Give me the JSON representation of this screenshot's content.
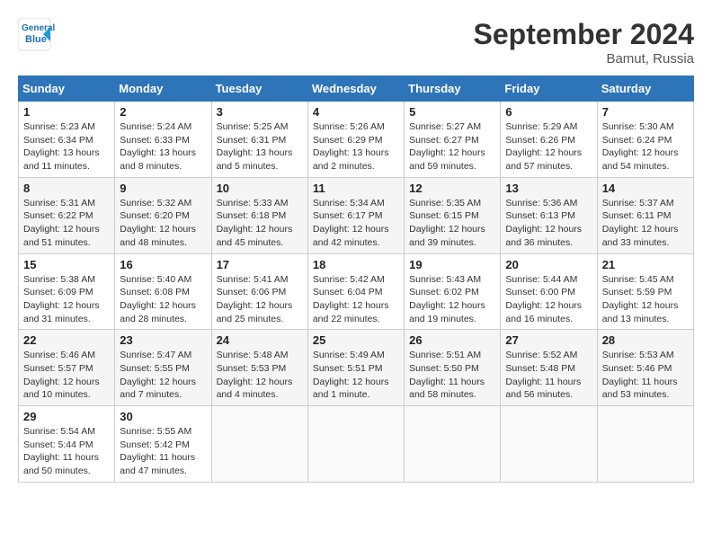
{
  "header": {
    "logo_line1": "General",
    "logo_line2": "Blue",
    "month_title": "September 2024",
    "location": "Bamut, Russia"
  },
  "days_of_week": [
    "Sunday",
    "Monday",
    "Tuesday",
    "Wednesday",
    "Thursday",
    "Friday",
    "Saturday"
  ],
  "weeks": [
    [
      {
        "day": "1",
        "sunrise": "5:23 AM",
        "sunset": "6:34 PM",
        "daylight": "13 hours and 11 minutes."
      },
      {
        "day": "2",
        "sunrise": "5:24 AM",
        "sunset": "6:33 PM",
        "daylight": "13 hours and 8 minutes."
      },
      {
        "day": "3",
        "sunrise": "5:25 AM",
        "sunset": "6:31 PM",
        "daylight": "13 hours and 5 minutes."
      },
      {
        "day": "4",
        "sunrise": "5:26 AM",
        "sunset": "6:29 PM",
        "daylight": "13 hours and 2 minutes."
      },
      {
        "day": "5",
        "sunrise": "5:27 AM",
        "sunset": "6:27 PM",
        "daylight": "12 hours and 59 minutes."
      },
      {
        "day": "6",
        "sunrise": "5:29 AM",
        "sunset": "6:26 PM",
        "daylight": "12 hours and 57 minutes."
      },
      {
        "day": "7",
        "sunrise": "5:30 AM",
        "sunset": "6:24 PM",
        "daylight": "12 hours and 54 minutes."
      }
    ],
    [
      {
        "day": "8",
        "sunrise": "5:31 AM",
        "sunset": "6:22 PM",
        "daylight": "12 hours and 51 minutes."
      },
      {
        "day": "9",
        "sunrise": "5:32 AM",
        "sunset": "6:20 PM",
        "daylight": "12 hours and 48 minutes."
      },
      {
        "day": "10",
        "sunrise": "5:33 AM",
        "sunset": "6:18 PM",
        "daylight": "12 hours and 45 minutes."
      },
      {
        "day": "11",
        "sunrise": "5:34 AM",
        "sunset": "6:17 PM",
        "daylight": "12 hours and 42 minutes."
      },
      {
        "day": "12",
        "sunrise": "5:35 AM",
        "sunset": "6:15 PM",
        "daylight": "12 hours and 39 minutes."
      },
      {
        "day": "13",
        "sunrise": "5:36 AM",
        "sunset": "6:13 PM",
        "daylight": "12 hours and 36 minutes."
      },
      {
        "day": "14",
        "sunrise": "5:37 AM",
        "sunset": "6:11 PM",
        "daylight": "12 hours and 33 minutes."
      }
    ],
    [
      {
        "day": "15",
        "sunrise": "5:38 AM",
        "sunset": "6:09 PM",
        "daylight": "12 hours and 31 minutes."
      },
      {
        "day": "16",
        "sunrise": "5:40 AM",
        "sunset": "6:08 PM",
        "daylight": "12 hours and 28 minutes."
      },
      {
        "day": "17",
        "sunrise": "5:41 AM",
        "sunset": "6:06 PM",
        "daylight": "12 hours and 25 minutes."
      },
      {
        "day": "18",
        "sunrise": "5:42 AM",
        "sunset": "6:04 PM",
        "daylight": "12 hours and 22 minutes."
      },
      {
        "day": "19",
        "sunrise": "5:43 AM",
        "sunset": "6:02 PM",
        "daylight": "12 hours and 19 minutes."
      },
      {
        "day": "20",
        "sunrise": "5:44 AM",
        "sunset": "6:00 PM",
        "daylight": "12 hours and 16 minutes."
      },
      {
        "day": "21",
        "sunrise": "5:45 AM",
        "sunset": "5:59 PM",
        "daylight": "12 hours and 13 minutes."
      }
    ],
    [
      {
        "day": "22",
        "sunrise": "5:46 AM",
        "sunset": "5:57 PM",
        "daylight": "12 hours and 10 minutes."
      },
      {
        "day": "23",
        "sunrise": "5:47 AM",
        "sunset": "5:55 PM",
        "daylight": "12 hours and 7 minutes."
      },
      {
        "day": "24",
        "sunrise": "5:48 AM",
        "sunset": "5:53 PM",
        "daylight": "12 hours and 4 minutes."
      },
      {
        "day": "25",
        "sunrise": "5:49 AM",
        "sunset": "5:51 PM",
        "daylight": "12 hours and 1 minute."
      },
      {
        "day": "26",
        "sunrise": "5:51 AM",
        "sunset": "5:50 PM",
        "daylight": "11 hours and 58 minutes."
      },
      {
        "day": "27",
        "sunrise": "5:52 AM",
        "sunset": "5:48 PM",
        "daylight": "11 hours and 56 minutes."
      },
      {
        "day": "28",
        "sunrise": "5:53 AM",
        "sunset": "5:46 PM",
        "daylight": "11 hours and 53 minutes."
      }
    ],
    [
      {
        "day": "29",
        "sunrise": "5:54 AM",
        "sunset": "5:44 PM",
        "daylight": "11 hours and 50 minutes."
      },
      {
        "day": "30",
        "sunrise": "5:55 AM",
        "sunset": "5:42 PM",
        "daylight": "11 hours and 47 minutes."
      },
      null,
      null,
      null,
      null,
      null
    ]
  ],
  "labels": {
    "sunrise": "Sunrise:",
    "sunset": "Sunset:",
    "daylight": "Daylight:"
  }
}
